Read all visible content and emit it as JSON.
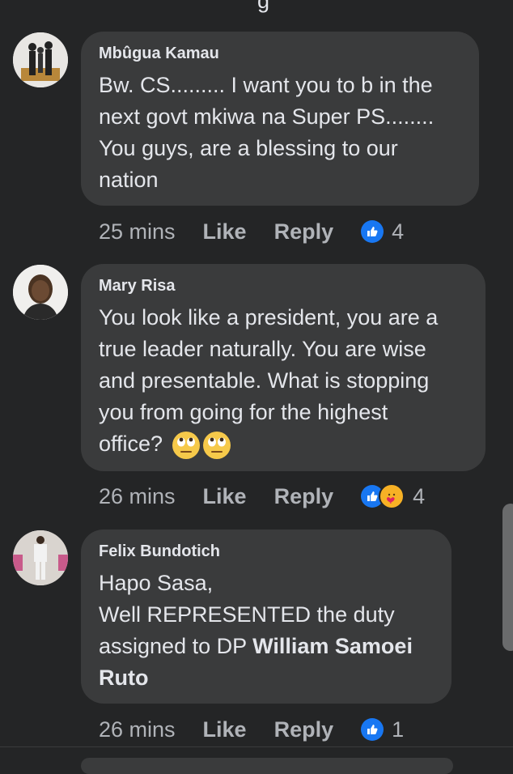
{
  "top_fragment": "g",
  "comments": [
    {
      "author": "Mbûgua Kamau",
      "text": "Bw. CS......... I want you to b in the\nnext govt mkiwa na Super PS........\nYou guys, are a blessing to our\nnation",
      "time": "25 mins",
      "like_label": "Like",
      "reply_label": "Reply",
      "reactions": [
        "like"
      ],
      "reaction_count": "4"
    },
    {
      "author": "Mary Risa",
      "text": "You look like a president, you are a\ntrue leader naturally. You are wise\nand presentable. What is stopping\nyou from going for the highest\noffice?",
      "emojis": [
        "face-with-rolling-eyes",
        "face-with-rolling-eyes"
      ],
      "time": "26 mins",
      "like_label": "Like",
      "reply_label": "Reply",
      "reactions": [
        "like",
        "care"
      ],
      "reaction_count": "4"
    },
    {
      "author": "Felix Bundotich",
      "text_plain": "Hapo Sasa,\nWell REPRESENTED the duty\nassigned to DP ",
      "text_bold": "William Samoei\nRuto",
      "time": "26 mins",
      "like_label": "Like",
      "reply_label": "Reply",
      "reactions": [
        "like"
      ],
      "reaction_count": "1"
    }
  ],
  "colors": {
    "background": "#242526",
    "bubble": "#3a3b3c",
    "text": "#e4e6eb",
    "secondary_text": "#b0b3b8",
    "like_blue": "#1877f2"
  }
}
